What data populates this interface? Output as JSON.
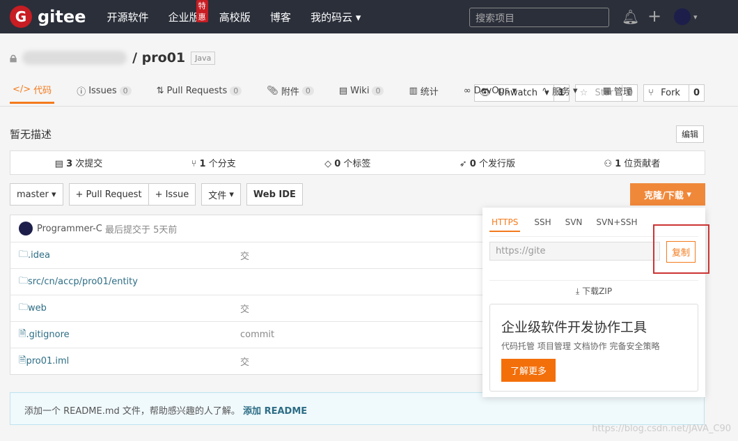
{
  "topbar": {
    "logo": "gitee",
    "logo_mark": "G",
    "nav": [
      "开源软件",
      "企业版",
      "高校版",
      "博客",
      "我的码云"
    ],
    "promo_badge": "特惠",
    "search_placeholder": "搜索项目"
  },
  "repo": {
    "name": "/ pro01",
    "language": "Java",
    "watch": {
      "label": "Unwatch",
      "count": "1"
    },
    "star": {
      "label": "Star",
      "count": "0"
    },
    "fork": {
      "label": "Fork",
      "count": "0"
    }
  },
  "tabs": [
    {
      "label": "代码"
    },
    {
      "label": "Issues",
      "count": "0"
    },
    {
      "label": "Pull Requests",
      "count": "0"
    },
    {
      "label": "附件",
      "count": "0"
    },
    {
      "label": "Wiki",
      "count": "0"
    },
    {
      "label": "统计"
    },
    {
      "label": "DevOps"
    },
    {
      "label": "服务"
    },
    {
      "label": "管理"
    }
  ],
  "description": "暂无描述",
  "edit": "编辑",
  "stats": [
    {
      "n": "3",
      "l": "次提交"
    },
    {
      "n": "1",
      "l": "个分支"
    },
    {
      "n": "0",
      "l": "个标签"
    },
    {
      "n": "0",
      "l": "个发行版"
    },
    {
      "n": "1",
      "l": "位贡献者"
    }
  ],
  "toolbar": {
    "branch": "master",
    "pr": "+ Pull Request",
    "issue": "+ Issue",
    "file": "文件",
    "webide": "Web IDE",
    "clone": "克隆/下载"
  },
  "commit": {
    "author": "Programmer-C",
    "text": "最后提交于 5天前"
  },
  "files": [
    {
      "name": ".idea",
      "type": "folder",
      "msg": "交"
    },
    {
      "name": "src/cn/accp/pro01/entity",
      "type": "folder",
      "msg": ""
    },
    {
      "name": "web",
      "type": "folder",
      "msg": "交"
    },
    {
      "name": ".gitignore",
      "type": "file",
      "msg": "commit"
    },
    {
      "name": "pro01.iml",
      "type": "file",
      "msg": "交"
    }
  ],
  "readme": {
    "text": "添加一个 README.md 文件，帮助感兴趣的人了解。",
    "link": "添加 README"
  },
  "clone_popup": {
    "tabs": [
      "HTTPS",
      "SSH",
      "SVN",
      "SVN+SSH"
    ],
    "url": "https://gite",
    "copy": "复制",
    "zip": "下载ZIP",
    "promo_title": "企业级软件开发协作工具",
    "promo_sub": "代码托管 项目管理 文档协作 完备安全策略",
    "promo_btn": "了解更多"
  },
  "watermark": "https://blog.csdn.net/JAVA_C90"
}
